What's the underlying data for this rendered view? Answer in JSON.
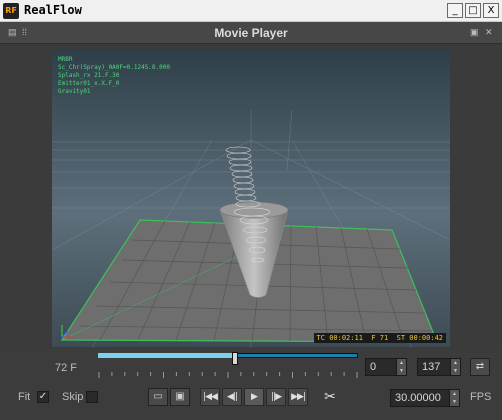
{
  "window": {
    "app_icon_text": "RF",
    "title": "RealFlow",
    "buttons": {
      "minimize": "_",
      "maximize": "□",
      "close": "X"
    }
  },
  "panel": {
    "title": "Movie Player"
  },
  "viewport": {
    "overlay_lines": [
      "MRBR",
      "Sc_Chr(Spray)_0A0F=0.1245.8.000",
      "Splash_rx 21.F.30",
      "Emitter01_x.X.F_0",
      "Gravity01"
    ],
    "timecode": "TC 00:02:11",
    "frame": "F 71",
    "start_time": "ST 00:00:42"
  },
  "controls": {
    "current_frame_label": "72 F",
    "range_start": "0",
    "range_end": "137",
    "fit_label": "Fit",
    "fit_checked": true,
    "skip_label": "Skip",
    "skip_checked": false,
    "fps_value": "30.00000",
    "fps_label": "FPS",
    "playhead_frame": 72,
    "total_frames": 137
  },
  "colors": {
    "timeline": "#1d7fa8",
    "overlay_text": "#52d47c",
    "readout_text": "#e8c93a"
  }
}
